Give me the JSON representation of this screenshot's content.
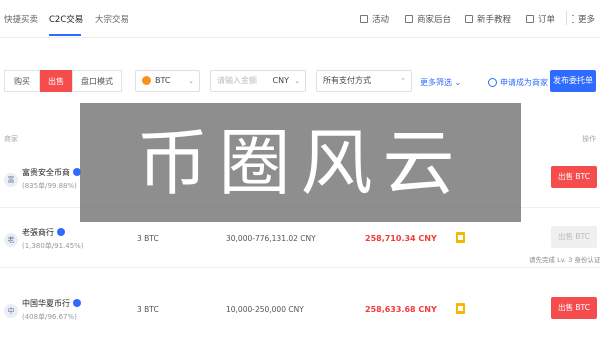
{
  "topnav": {
    "tabs": [
      "快捷买卖",
      "C2C交易",
      "大宗交易"
    ],
    "items": [
      {
        "label": "活动",
        "icon": "activity-icon"
      },
      {
        "label": "商家后台",
        "icon": "merchant-backend-icon"
      },
      {
        "label": "新手教程",
        "icon": "tutorial-icon"
      },
      {
        "label": "订单",
        "icon": "orders-icon"
      },
      {
        "label": "更多",
        "icon": "more-icon"
      }
    ]
  },
  "filter": {
    "buy_label": "购买",
    "sell_label": "出售",
    "depth_label": "盘口模式",
    "coin": "BTC",
    "amount_placeholder": "请输入金额",
    "currency": "CNY",
    "payment": "所有支付方式",
    "more_filter": "更多筛选",
    "apply_merchant": "申请成为商家",
    "publish": "发布委托单"
  },
  "table": {
    "header_merchant": "商家",
    "header_action": "操作",
    "rows": [
      {
        "avatar": "富",
        "name": "富贵安全币商",
        "stats": "(835单/99.88%)",
        "amount": "",
        "limit": "",
        "price": "",
        "action": "出售 BTC",
        "enabled": true,
        "note": ""
      },
      {
        "avatar": "老",
        "name": "老張商行",
        "stats": "(1,380单/91.45%)",
        "amount": "3 BTC",
        "limit": "30,000-776,131.02 CNY",
        "price": "258,710.34 CNY",
        "action": "出售 BTC",
        "enabled": false,
        "note": "请先完成 Lv. 3 身份认证"
      },
      {
        "avatar": "中",
        "name": "中国华夏币行",
        "stats": "(408单/96.67%)",
        "amount": "3 BTC",
        "limit": "10,000-250,000 CNY",
        "price": "258,633.68 CNY",
        "action": "出售 BTC",
        "enabled": true,
        "note": ""
      }
    ]
  },
  "watermark": "币圈风云",
  "colors": {
    "accent": "#2f6bff",
    "sell": "#f54d4d",
    "price": "#f03c3c",
    "watermark_bg": "#6e6e6e"
  }
}
